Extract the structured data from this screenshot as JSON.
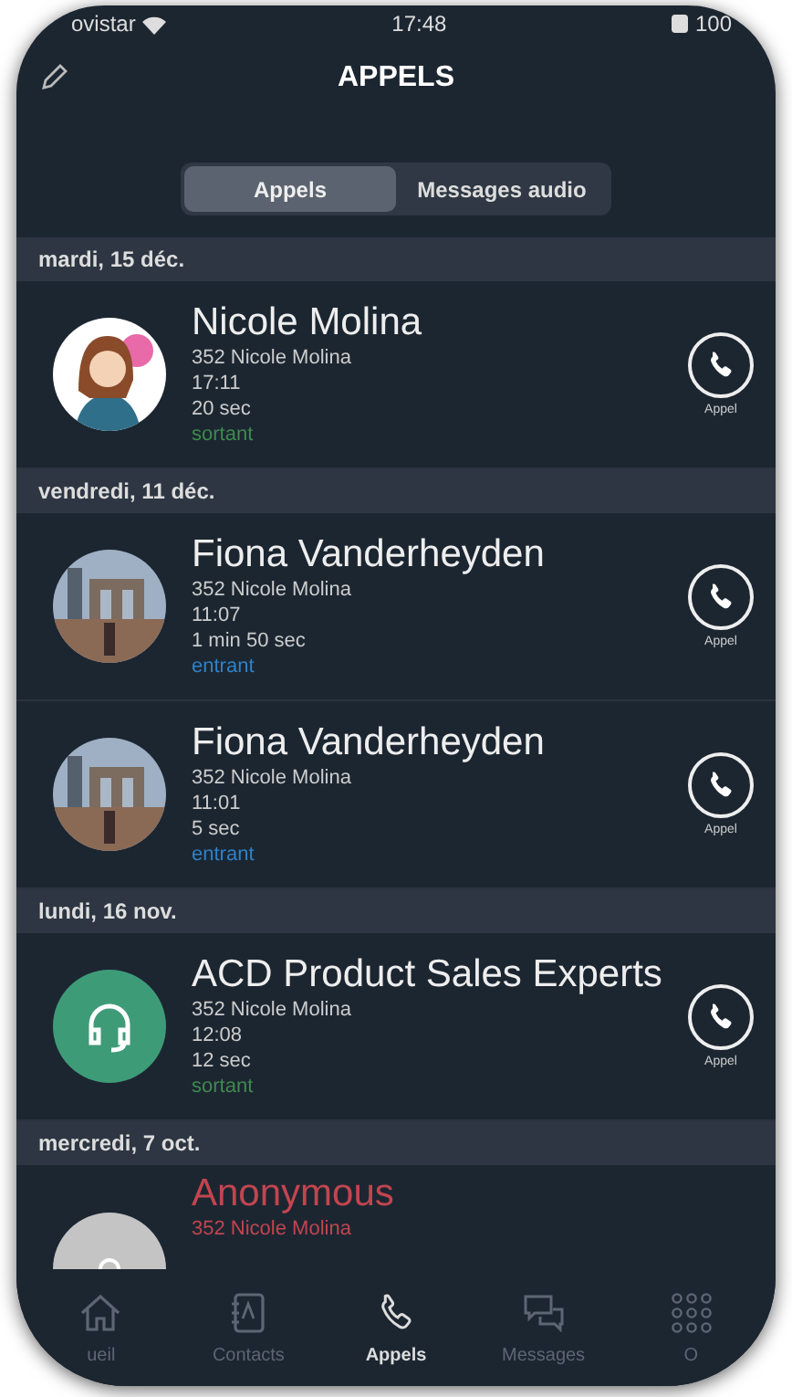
{
  "status_bar": {
    "carrier": "ovistar",
    "time": "17:48",
    "battery": "100"
  },
  "header": {
    "title": "APPELS"
  },
  "segments": [
    {
      "label": "Appels",
      "selected": true
    },
    {
      "label": "Messages audio",
      "selected": false
    }
  ],
  "groups": [
    {
      "date": "mardi, 15 déc.",
      "calls": [
        {
          "name": "Nicole Molina",
          "avatar": {
            "kind": "figure"
          },
          "missed": false,
          "line": "352 Nicole Molina",
          "time": "17:11",
          "duration": "20 sec",
          "direction": {
            "kind": "outgoing",
            "label": "sortant"
          },
          "action": "Appel"
        }
      ]
    },
    {
      "date": "vendredi, 11 déc.",
      "calls": [
        {
          "name": "Fiona Vanderheyden",
          "missed": false,
          "line": "352 Nicole Molina",
          "time": "11:07",
          "duration": "1 min 50 sec",
          "direction": {
            "kind": "incoming",
            "label": "entrant"
          },
          "action": "Appel"
        },
        {
          "name": "Fiona Vanderheyden",
          "missed": false,
          "line": "352 Nicole Molina",
          "time": "11:01",
          "duration": "5 sec",
          "direction": {
            "kind": "incoming",
            "label": "entrant"
          },
          "action": "Appel"
        }
      ]
    },
    {
      "date": "lundi, 16 nov.",
      "calls": [
        {
          "name": "ACD Product Sales Experts",
          "avatar": {
            "kind": "headset"
          },
          "missed": false,
          "line": "352 Nicole Molina",
          "time": "12:08",
          "duration": "12 sec",
          "direction": {
            "kind": "outgoing",
            "label": "sortant"
          },
          "action": "Appel"
        }
      ]
    },
    {
      "date": "mercredi, 7 oct.",
      "calls": [
        {
          "name": "Anonymous",
          "avatar": {
            "kind": "generic"
          },
          "missed": true,
          "line": "352 Nicole Molina"
        }
      ]
    }
  ],
  "tab_bar": [
    {
      "kind": "home",
      "label": "ueil",
      "selected": false
    },
    {
      "kind": "contacts",
      "label": "Contacts",
      "selected": false
    },
    {
      "kind": "calls",
      "label": "Appels",
      "selected": true
    },
    {
      "kind": "messages",
      "label": "Messages",
      "selected": false
    },
    {
      "kind": "more",
      "label": "O",
      "selected": false
    }
  ]
}
